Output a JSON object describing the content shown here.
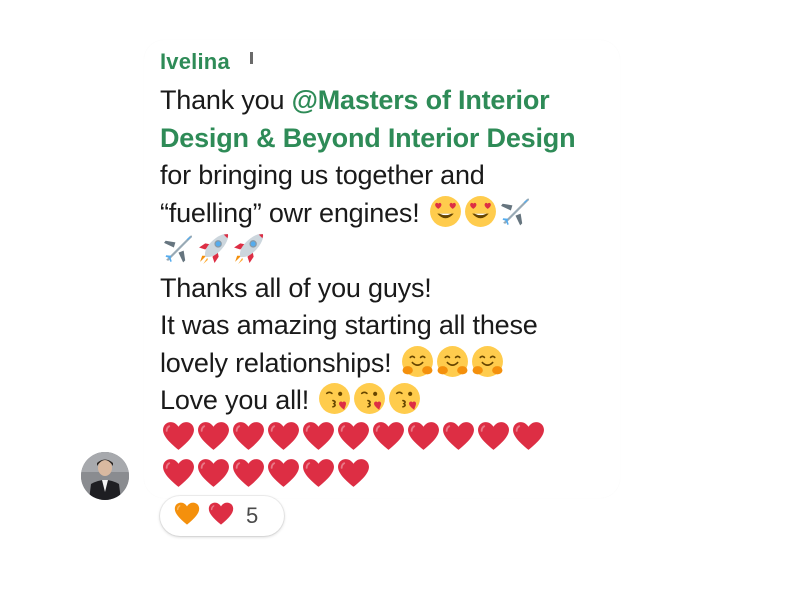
{
  "message": {
    "sender": "Ivelina",
    "line1_before": "Thank you ",
    "mention_line1": "@Masters of Interior",
    "mention_line2": "Design & Beyond Interior Design",
    "line3": "for bringing us together and",
    "line4": "“fuelling” owr engines!",
    "line6": "Thanks all of you guys!",
    "line7": "It was amazing starting all these",
    "line8": "lovely relationships!",
    "line9": "Love you all!",
    "emoji_line4": [
      "heart-eyes",
      "heart-eyes",
      "airplane"
    ],
    "emoji_line5": [
      "airplane",
      "rocket",
      "rocket"
    ],
    "emoji_line8": [
      "hugging",
      "hugging",
      "hugging"
    ],
    "emoji_line9": [
      "kissing-heart",
      "kissing-heart",
      "kissing-heart"
    ],
    "emoji_line10": [
      "red-heart",
      "red-heart",
      "red-heart",
      "red-heart",
      "red-heart",
      "red-heart",
      "red-heart",
      "red-heart",
      "red-heart",
      "red-heart",
      "red-heart"
    ],
    "emoji_line11": [
      "red-heart",
      "red-heart",
      "red-heart",
      "red-heart",
      "red-heart",
      "red-heart"
    ]
  },
  "reactions": {
    "icons": [
      "orange-heart",
      "red-heart"
    ],
    "count": "5"
  },
  "colors": {
    "sender": "#2e8b57",
    "mention": "#2e8b57",
    "text": "#1a1a1a",
    "heart_red": "#dd2e44",
    "heart_orange": "#f4900c"
  }
}
